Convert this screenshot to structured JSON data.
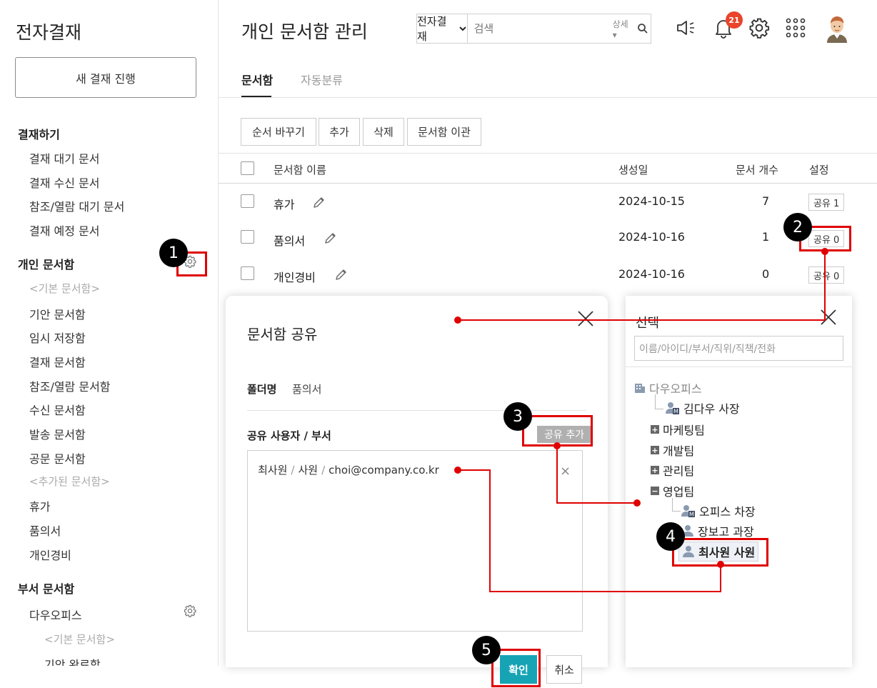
{
  "sidebar": {
    "title": "전자결재",
    "new_button": "새 결재 진행",
    "sections": {
      "approve": "결재하기",
      "personal": "개인 문서함",
      "dept": "부서 문서함"
    },
    "approve_items": [
      "결재 대기 문서",
      "결재 수신 문서",
      "참조/열람 대기 문서",
      "결재 예정 문서"
    ],
    "personal_default_header": "<기본 문서함>",
    "personal_default_items": [
      "기안 문서함",
      "임시 저장함",
      "결재 문서함",
      "참조/열람 문서함",
      "수신 문서함",
      "발송 문서함",
      "공문 문서함"
    ],
    "personal_added_header": "<추가된 문서함>",
    "personal_added_items": [
      "휴가",
      "품의서",
      "개인경비"
    ],
    "dept_org": "다우오피스",
    "dept_default_header": "<기본 문서함>",
    "dept_partial_item": "기안 완료함"
  },
  "header": {
    "title": "개인 문서함 관리",
    "search_scope": "전자결재",
    "search_placeholder": "검색",
    "search_detail": "상세",
    "notification_count": "21"
  },
  "tabs": [
    "문서함",
    "자동분류"
  ],
  "toolbar": [
    "순서 바꾸기",
    "추가",
    "삭제",
    "문서함 이관"
  ],
  "table": {
    "columns": [
      "문서함 이름",
      "생성일",
      "문서 개수",
      "설정"
    ],
    "rows": [
      {
        "name": "휴가",
        "date": "2024-10-15",
        "count": "7",
        "share": "공유 1"
      },
      {
        "name": "품의서",
        "date": "2024-10-16",
        "count": "1",
        "share": "공유 0"
      },
      {
        "name": "개인경비",
        "date": "2024-10-16",
        "count": "0",
        "share": "공유 0"
      }
    ]
  },
  "share_modal": {
    "title": "문서함 공유",
    "folder_label": "폴더명",
    "folder_value": "품의서",
    "users_label": "공유 사용자 / 부서",
    "add_button": "공유 추가",
    "entry": {
      "name": "최사원",
      "position": "사원",
      "email": "choi@company.co.kr"
    },
    "confirm": "확인",
    "cancel": "취소"
  },
  "select_panel": {
    "title": "선택",
    "search_placeholder": "이름/아이디/부서/직위/직책/전화",
    "root": "다우오피스",
    "ceo": "김다우 사장",
    "teams": [
      "마케팅팀",
      "개발팀",
      "관리팀",
      "영업팀"
    ],
    "sales_members": [
      "오피스 차장",
      "장보고 과장",
      "최사원 사원"
    ]
  },
  "annotations": [
    "1",
    "2",
    "3",
    "4",
    "5"
  ],
  "colors": {
    "accent": "#16a4b5",
    "annotation": "#e00000",
    "badge": "#e8452c"
  }
}
